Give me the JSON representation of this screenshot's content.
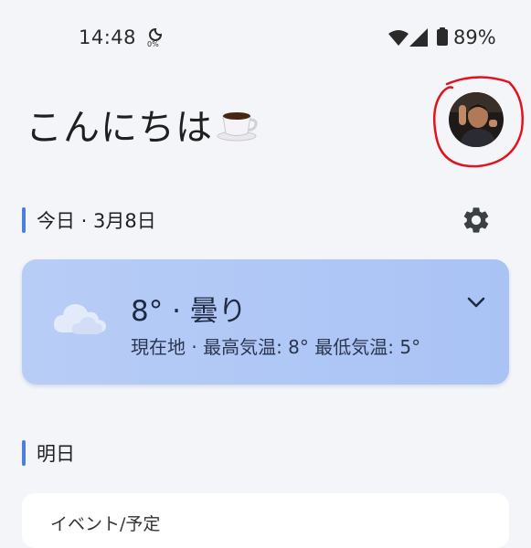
{
  "status_bar": {
    "time": "14:48",
    "data_saver": "0%",
    "battery": "89%",
    "icons": [
      "data-saver-icon",
      "wifi-icon",
      "cellular-signal-icon",
      "battery-icon"
    ]
  },
  "greeting": {
    "text": "こんにちは",
    "emoji_icon": "coffee-icon"
  },
  "today": {
    "label": "今日 · 3月8日",
    "settings_icon": "gear-icon"
  },
  "weather": {
    "main": "8° · 曇り",
    "details": "現在地 · 最高気温: 8° 最低気温: 5°",
    "icon": "cloud-icon",
    "expand_icon": "chevron-down-icon"
  },
  "tomorrow": {
    "label": "明日",
    "event_label": "イベント/予定"
  },
  "colors": {
    "background": "#f3f5f9",
    "accent": "#4a7fe0",
    "weather_card": "#b0c8f5",
    "annotation": "#e0141e"
  }
}
